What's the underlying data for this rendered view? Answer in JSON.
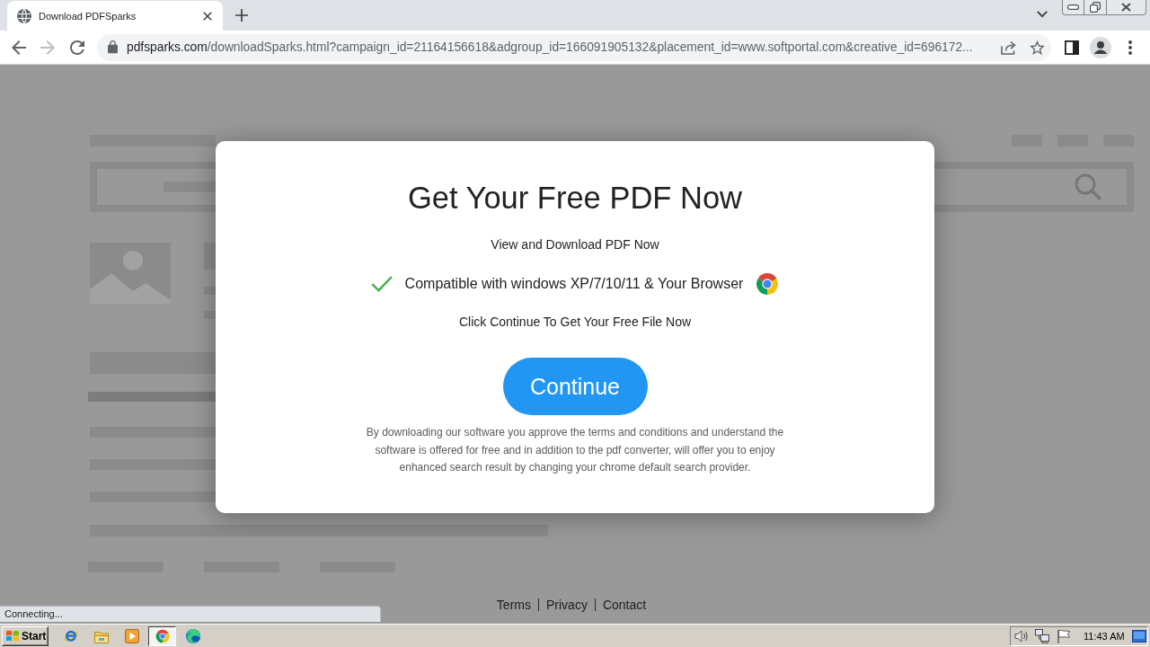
{
  "browser": {
    "tabs": [
      {
        "title": "Download PDFSparks",
        "selected": true
      }
    ],
    "nav": [
      {
        "kind": "back",
        "disabled": false
      },
      {
        "kind": "forward",
        "disabled": true
      },
      {
        "kind": "reload",
        "disabled": false
      }
    ],
    "address": {
      "host": "pdfsparks.com",
      "path": "/downloadSparks.html?campaign_id=21164156618&adgroup_id=166091905132&placement_id=www.softportal.com&creative_id=696172..."
    },
    "status": "Connecting..."
  },
  "dialog": {
    "title": "Get Your Free PDF Now",
    "subtitle": "View and Download PDF Now",
    "compatibility": "Compatible with windows XP/7/10/11 & Your Browser",
    "instruction": "Click Continue To Get Your Free File Now",
    "button": "Continue",
    "disclaimer": "By downloading our software you approve the terms and conditions and understand the software is offered for free and in addition to the pdf converter, will offer you to enjoy enhanced search result by changing your chrome default search provider."
  },
  "footer": {
    "links": [
      "Terms",
      "Privacy",
      "Contact"
    ]
  },
  "taskbar": {
    "start": "Start",
    "apps": [
      {
        "kind": "ie",
        "active": false
      },
      {
        "kind": "folder",
        "active": false
      },
      {
        "kind": "media",
        "active": false
      },
      {
        "kind": "chrome",
        "active": true
      },
      {
        "kind": "edge",
        "active": false
      }
    ],
    "clock": "11:43 AM"
  }
}
